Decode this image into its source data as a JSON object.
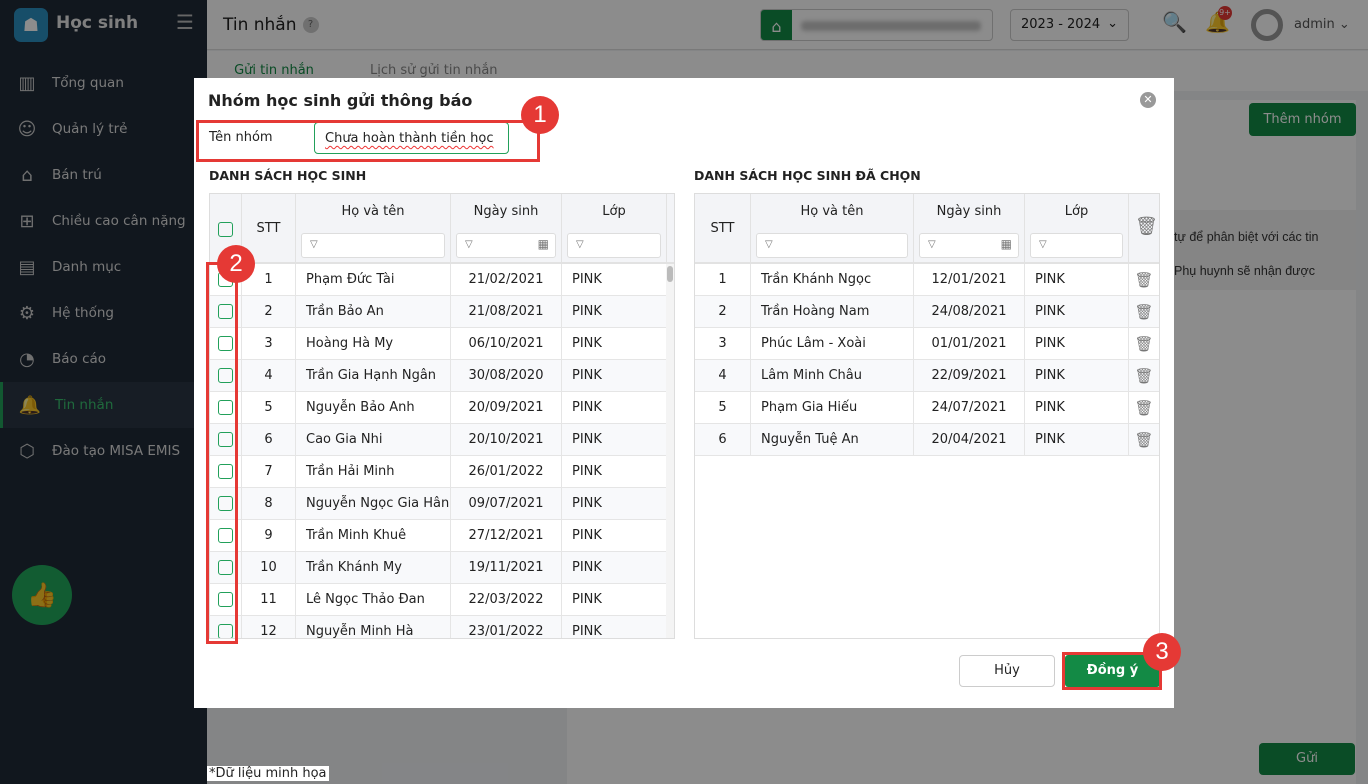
{
  "app": {
    "brand": "Học sinh",
    "page_title": "Tin nhắn",
    "help": "?",
    "school_year": "2023 - 2024",
    "notif_badge": "9+",
    "user": "admin"
  },
  "sidebar": {
    "items": [
      {
        "label": "Tổng quan",
        "icon": "chart-bars-icon"
      },
      {
        "label": "Quản lý trẻ",
        "icon": "child-icon"
      },
      {
        "label": "Bán trú",
        "icon": "house-icon"
      },
      {
        "label": "Chiều cao cân nặng",
        "icon": "scale-icon"
      },
      {
        "label": "Danh mục",
        "icon": "folder-icon"
      },
      {
        "label": "Hệ thống",
        "icon": "gear-icon"
      },
      {
        "label": "Báo cáo",
        "icon": "pie-chart-icon"
      },
      {
        "label": "Tin nhắn",
        "icon": "bell-icon",
        "active": true
      },
      {
        "label": "Đào tạo MISA EMIS",
        "icon": "cube-icon"
      }
    ]
  },
  "tabs": [
    "Gửi tin nhắn",
    "Lịch sử gửi tin nhắn"
  ],
  "background": {
    "add_group": "Thêm nhóm",
    "note_line1": "tự để phân biệt với các tin",
    "note_line2": "Phụ huynh sẽ nhận được",
    "send": "Gửi",
    "footnote": "*Dữ liệu minh họa"
  },
  "modal": {
    "title": "Nhóm học sinh gửi thông báo",
    "group_label": "Tên nhóm",
    "group_value": "Chưa hoàn thành tiền học",
    "left_title": "DANH SÁCH HỌC SINH",
    "right_title": "DANH SÁCH HỌC SINH ĐÃ CHỌN",
    "columns": {
      "stt": "STT",
      "name": "Họ và tên",
      "dob": "Ngày sinh",
      "class": "Lớp"
    },
    "students": [
      {
        "stt": "1",
        "name": "Phạm Đức Tài",
        "dob": "21/02/2021",
        "class": "PINK"
      },
      {
        "stt": "2",
        "name": "Trần Bảo An",
        "dob": "21/08/2021",
        "class": "PINK"
      },
      {
        "stt": "3",
        "name": "Hoàng Hà My",
        "dob": "06/10/2021",
        "class": "PINK"
      },
      {
        "stt": "4",
        "name": "Trần Gia Hạnh Ngân",
        "dob": "30/08/2020",
        "class": "PINK"
      },
      {
        "stt": "5",
        "name": "Nguyễn Bảo Anh",
        "dob": "20/09/2021",
        "class": "PINK"
      },
      {
        "stt": "6",
        "name": "Cao Gia Nhi",
        "dob": "20/10/2021",
        "class": "PINK"
      },
      {
        "stt": "7",
        "name": "Trần Hải Minh",
        "dob": "26/01/2022",
        "class": "PINK"
      },
      {
        "stt": "8",
        "name": "Nguyễn Ngọc Gia Hân",
        "dob": "09/07/2021",
        "class": "PINK"
      },
      {
        "stt": "9",
        "name": "Trần Minh Khuê",
        "dob": "27/12/2021",
        "class": "PINK"
      },
      {
        "stt": "10",
        "name": "Trần Khánh My",
        "dob": "19/11/2021",
        "class": "PINK"
      },
      {
        "stt": "11",
        "name": "Lê Ngọc Thảo Đan",
        "dob": "22/03/2022",
        "class": "PINK"
      },
      {
        "stt": "12",
        "name": "Nguyễn Minh Hà",
        "dob": "23/01/2022",
        "class": "PINK"
      }
    ],
    "selected": [
      {
        "stt": "1",
        "name": "Trần Khánh Ngọc",
        "dob": "12/01/2021",
        "class": "PINK"
      },
      {
        "stt": "2",
        "name": "Trần Hoàng Nam",
        "dob": "24/08/2021",
        "class": "PINK"
      },
      {
        "stt": "3",
        "name": "Phúc Lâm - Xoài",
        "dob": "01/01/2021",
        "class": "PINK"
      },
      {
        "stt": "4",
        "name": "Lâm Minh Châu",
        "dob": "22/09/2021",
        "class": "PINK"
      },
      {
        "stt": "5",
        "name": "Phạm Gia Hiếu",
        "dob": "24/07/2021",
        "class": "PINK"
      },
      {
        "stt": "6",
        "name": "Nguyễn Tuệ An",
        "dob": "20/04/2021",
        "class": "PINK"
      }
    ],
    "cancel": "Hủy",
    "ok": "Đồng ý"
  },
  "annotations": [
    "1",
    "2",
    "3"
  ]
}
